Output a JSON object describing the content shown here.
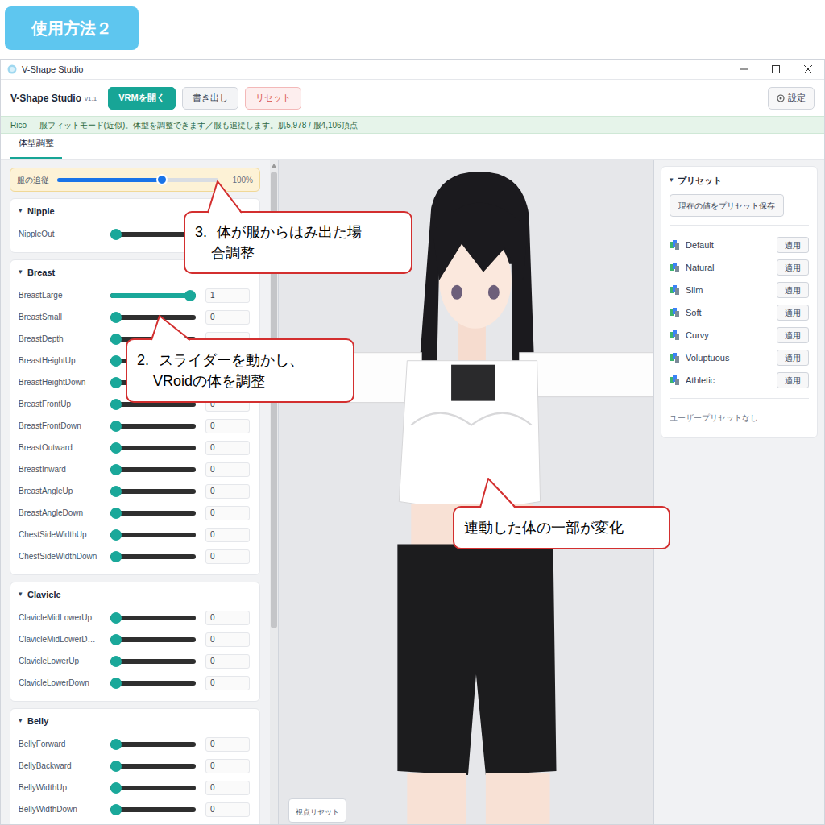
{
  "badge": "使用方法２",
  "window": {
    "title": "V-Shape Studio"
  },
  "toolbar": {
    "app_name": "V-Shape Studio",
    "version": "v1.1",
    "buttons": [
      {
        "label": "VRMを開く",
        "kind": "primary"
      },
      {
        "label": "書き出し",
        "kind": "secondary"
      },
      {
        "label": "リセット",
        "kind": "danger"
      }
    ],
    "settings": "設定"
  },
  "status_bar": "Rico — 服フィットモード(近似)。体型を調整できます／服も追従します。肌5,978 / 服4,106頂点",
  "tabs": [
    {
      "label": "体型調整",
      "selected": true
    }
  ],
  "follow": {
    "label": "服の追従",
    "level": 0.66,
    "reading": "100%"
  },
  "sections": [
    {
      "toggle": "▾",
      "title": "Nipple",
      "sliders": [
        {
          "name": "NippleOut",
          "level": 0
        }
      ]
    },
    {
      "toggle": "▾",
      "title": "Breast",
      "sliders": [
        {
          "name": "BreastLarge",
          "level": 1,
          "value": "1"
        },
        {
          "name": "BreastSmall",
          "level": 0,
          "value": "0"
        },
        {
          "name": "BreastDepth",
          "level": 0
        },
        {
          "name": "BreastHeightUp",
          "level": 0
        },
        {
          "name": "BreastHeightDown",
          "level": 0
        },
        {
          "name": "BreastFrontUp",
          "level": 0,
          "value": "0"
        },
        {
          "name": "BreastFrontDown",
          "level": 0,
          "value": "0"
        },
        {
          "name": "BreastOutward",
          "level": 0,
          "value": "0"
        },
        {
          "name": "BreastInward",
          "level": 0,
          "value": "0"
        },
        {
          "name": "BreastAngleUp",
          "level": 0,
          "value": "0"
        },
        {
          "name": "BreastAngleDown",
          "level": 0,
          "value": "0"
        },
        {
          "name": "ChestSideWidthUp",
          "level": 0,
          "value": "0"
        },
        {
          "name": "ChestSideWidthDown",
          "level": 0,
          "value": "0"
        }
      ]
    },
    {
      "toggle": "▾",
      "title": "Clavicle",
      "sliders": [
        {
          "name": "ClavicleMidLowerUp",
          "level": 0,
          "value": "0"
        },
        {
          "name": "ClavicleMidLowerD…",
          "level": 0,
          "value": "0"
        },
        {
          "name": "ClavicleLowerUp",
          "level": 0,
          "value": "0"
        },
        {
          "name": "ClavicleLowerDown",
          "level": 0,
          "value": "0"
        }
      ]
    },
    {
      "toggle": "▾",
      "title": "Belly",
      "sliders": [
        {
          "name": "BellyForward",
          "level": 0,
          "value": "0"
        },
        {
          "name": "BellyBackward",
          "level": 0,
          "value": "0"
        },
        {
          "name": "BellyWidthUp",
          "level": 0,
          "value": "0"
        },
        {
          "name": "BellyWidthDown",
          "level": 0,
          "value": "0"
        }
      ]
    }
  ],
  "viewport": {
    "reset_button": "視点リセット"
  },
  "presets": {
    "toggle": "▾",
    "title": "プリセット",
    "save_button": "現在の値をプリセット保存",
    "items": [
      {
        "name": "Default",
        "button": "適用"
      },
      {
        "name": "Natural",
        "button": "適用"
      },
      {
        "name": "Slim",
        "button": "適用"
      },
      {
        "name": "Soft",
        "button": "適用"
      },
      {
        "name": "Curvy",
        "button": "適用"
      },
      {
        "name": "Voluptuous",
        "button": "適用"
      },
      {
        "name": "Athletic",
        "button": "適用"
      }
    ],
    "empty": "ユーザープリセットなし"
  },
  "callouts": [
    {
      "number": "3.",
      "lines": [
        "体が服からはみ出た場",
        "合調整"
      ]
    },
    {
      "number": "2.",
      "lines": [
        "スライダーを動かし、",
        "VRoidの体を調整"
      ]
    },
    {
      "lines": [
        "連動した体の一部が変化"
      ]
    }
  ]
}
